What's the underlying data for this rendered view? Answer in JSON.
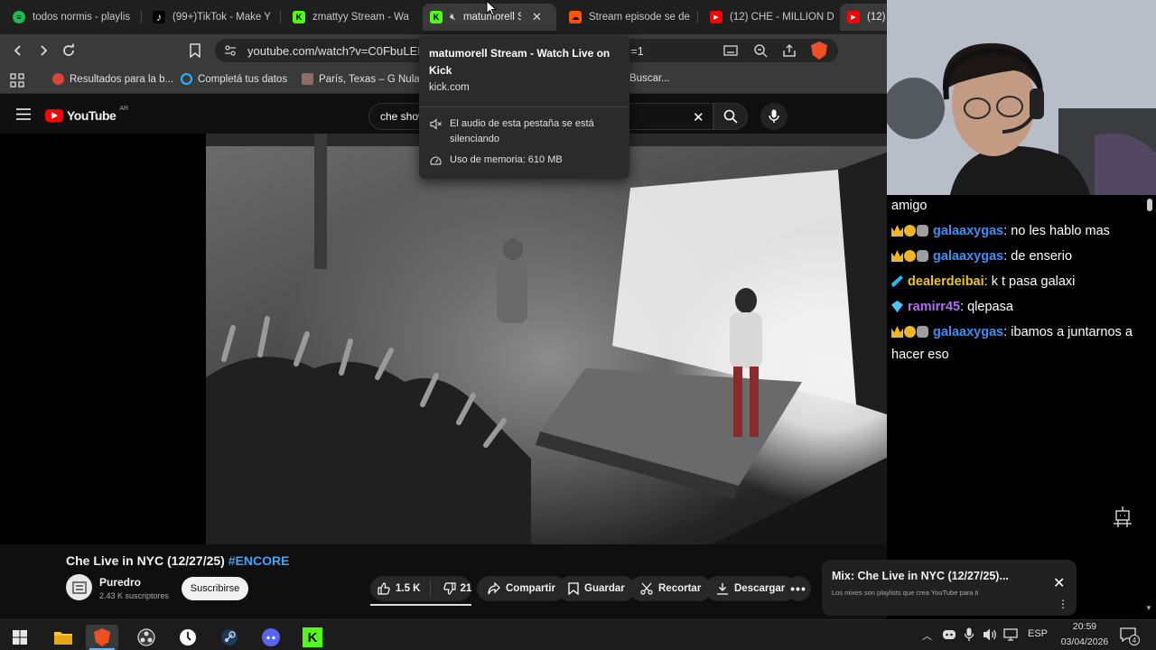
{
  "browser": {
    "tabs": [
      {
        "title": "todos normis - playlis",
        "icon": "spotify-icon",
        "color": "#1db954"
      },
      {
        "title": "(99+)TikTok - Make Y",
        "icon": "tiktok-icon",
        "color": "#ffffff"
      },
      {
        "title": "zmattyy Stream - Wa",
        "icon": "kick-icon",
        "color": "#53fc18"
      },
      {
        "title": "matumorell St",
        "icon": "kick-icon",
        "color": "#53fc18",
        "active": true,
        "muted": true
      },
      {
        "title": "Stream episode se de",
        "icon": "soundcloud-icon",
        "color": "#ff5500"
      },
      {
        "title": "(12) CHE - MILLION D",
        "icon": "youtube-icon",
        "color": "#ff0000"
      },
      {
        "title": "(12)",
        "icon": "youtube-icon",
        "color": "#ff0000"
      }
    ],
    "url": "youtube.com/watch?v=C0FbuLEI",
    "url_tail": "=1",
    "bookmarks": [
      {
        "label": "Resultados para la b...",
        "color": "#db4437"
      },
      {
        "label": "Completá tus datos",
        "color": "#29b6f6"
      },
      {
        "label": "París, Texas – G Nula",
        "color": "#8d6e63"
      },
      {
        "label": "Buscar...",
        "color": "#888888"
      }
    ]
  },
  "tooltip": {
    "title": "matumorell Stream - Watch Live on Kick",
    "domain": "kick.com",
    "audio_text": "El audio de esta pestaña se está silenciando",
    "memory_text": "Uso de memoria: 610 MB"
  },
  "youtube": {
    "logo": "YouTube",
    "country": "AR",
    "search_value": "che shov",
    "video_title": "Che Live in NYC (12/27/25)",
    "hashtag": "#ENCORE",
    "channel": "Puredro",
    "subscribers": "2.43 K suscriptores",
    "subscribe_label": "Suscribirse",
    "likes": "1.5 K",
    "dislikes": "21",
    "share": "Compartir",
    "save": "Guardar",
    "clip": "Recortar",
    "download": "Descargar",
    "mix_title": "Mix: Che Live in NYC (12/27/25)...",
    "mix_subtitle": "Los mixes son playlists que crea YouTube para ti"
  },
  "chat": {
    "first_line": "amigo",
    "messages": [
      {
        "user": "galaaxygas",
        "text": ": no les hablo mas",
        "user_color": "#3b8ff5",
        "badges": [
          "crown",
          "gold",
          "mic"
        ]
      },
      {
        "user": "galaaxygas",
        "text": ": de enserio",
        "user_color": "#3b8ff5",
        "badges": [
          "crown",
          "gold",
          "mic"
        ]
      },
      {
        "user": "dealerdeibai",
        "text": ": k t pasa galaxi",
        "user_color": "#f0c419",
        "badges": [
          "sword"
        ]
      },
      {
        "user": "ramirr45",
        "text": ": qlepasa",
        "user_color": "#b36cf5",
        "badges": [
          "gem"
        ]
      },
      {
        "user": "galaaxygas",
        "text": ": ibamos a juntarnos a hacer eso",
        "user_color": "#3b8ff5",
        "badges": [
          "crown",
          "gold",
          "mic"
        ]
      }
    ]
  },
  "taskbar": {
    "language": "ESP",
    "time": "20:59",
    "date": "03/04/2026",
    "notifications": "4"
  }
}
